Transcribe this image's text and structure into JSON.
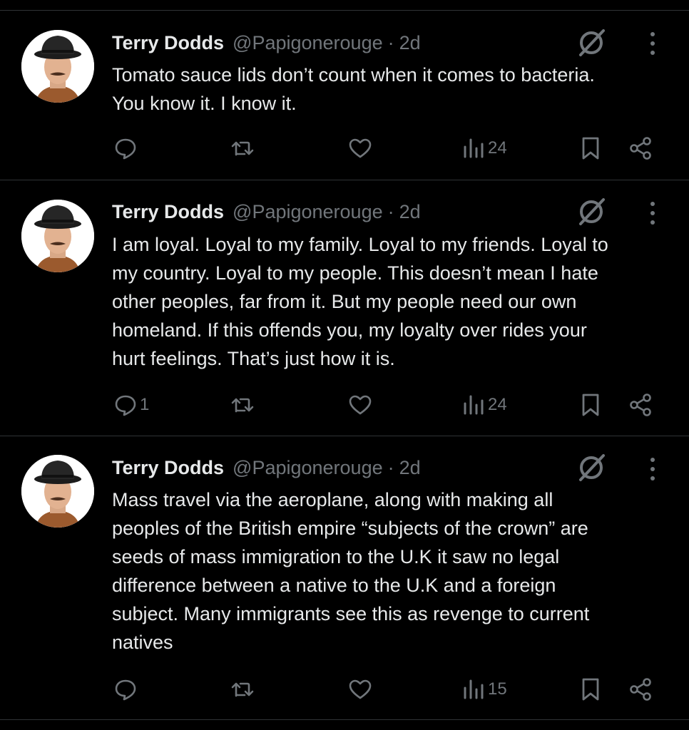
{
  "colors": {
    "background": "#000000",
    "text": "#e7e9ea",
    "muted": "#71767b",
    "divider": "#2f3336"
  },
  "tweets": [
    {
      "author_name": "Terry Dodds",
      "handle": "@Papigonerouge",
      "separator": "·",
      "time": "2d",
      "lines": [
        "Tomato sauce lids don’t count when it comes to bacteria.",
        "You know it. I know it."
      ],
      "reply_count": "",
      "view_count": "24"
    },
    {
      "author_name": "Terry Dodds",
      "handle": "@Papigonerouge",
      "separator": "·",
      "time": "2d",
      "lines": [
        "I am loyal. Loyal to my family. Loyal to my friends. Loyal to",
        "my country. Loyal to my people. This doesn’t mean I hate",
        "other peoples, far from it. But my people need our own",
        "homeland. If this offends you, my loyalty over rides your",
        "hurt feelings. That’s just how it is."
      ],
      "reply_count": "1",
      "view_count": "24"
    },
    {
      "author_name": "Terry Dodds",
      "handle": "@Papigonerouge",
      "separator": "·",
      "time": "2d",
      "lines": [
        "Mass travel via the aeroplane, along with making all",
        "peoples of the British empire “subjects of the crown” are",
        "seeds of mass immigration to the U.K it saw no legal",
        "difference between a native to the U.K and a foreign",
        "subject. Many immigrants see this as revenge to current",
        "natives"
      ],
      "reply_count": "",
      "view_count": "15"
    }
  ]
}
